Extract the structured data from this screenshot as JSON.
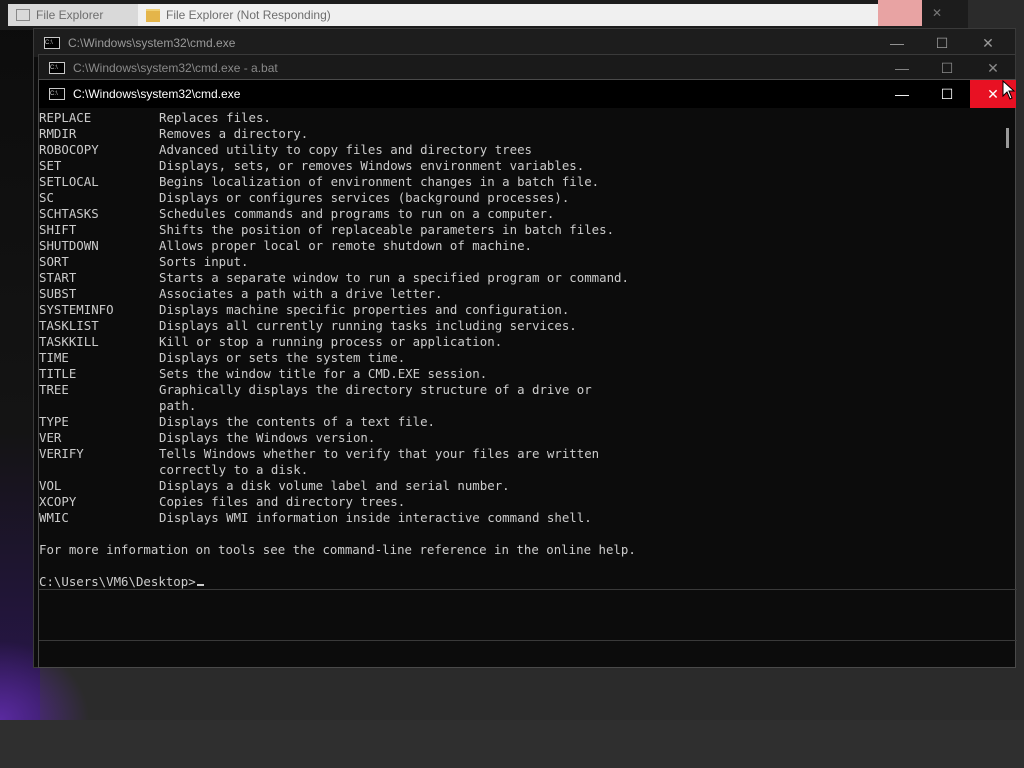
{
  "background_windows": {
    "tab1_title": "File Explorer",
    "tab2_title": "File Explorer (Not Responding)"
  },
  "window_back": {
    "title": "C:\\Windows\\system32\\cmd.exe"
  },
  "window_mid": {
    "title": "C:\\Windows\\system32\\cmd.exe - a.bat"
  },
  "window_front": {
    "title": "C:\\Windows\\system32\\cmd.exe"
  },
  "controls": {
    "minimize": "—",
    "maximize": "☐",
    "close": "✕"
  },
  "console": {
    "rows": [
      {
        "cmd": "REPLACE",
        "desc": "Replaces files."
      },
      {
        "cmd": "RMDIR",
        "desc": "Removes a directory."
      },
      {
        "cmd": "ROBOCOPY",
        "desc": "Advanced utility to copy files and directory trees"
      },
      {
        "cmd": "SET",
        "desc": "Displays, sets, or removes Windows environment variables."
      },
      {
        "cmd": "SETLOCAL",
        "desc": "Begins localization of environment changes in a batch file."
      },
      {
        "cmd": "SC",
        "desc": "Displays or configures services (background processes)."
      },
      {
        "cmd": "SCHTASKS",
        "desc": "Schedules commands and programs to run on a computer."
      },
      {
        "cmd": "SHIFT",
        "desc": "Shifts the position of replaceable parameters in batch files."
      },
      {
        "cmd": "SHUTDOWN",
        "desc": "Allows proper local or remote shutdown of machine."
      },
      {
        "cmd": "SORT",
        "desc": "Sorts input."
      },
      {
        "cmd": "START",
        "desc": "Starts a separate window to run a specified program or command."
      },
      {
        "cmd": "SUBST",
        "desc": "Associates a path with a drive letter."
      },
      {
        "cmd": "SYSTEMINFO",
        "desc": "Displays machine specific properties and configuration."
      },
      {
        "cmd": "TASKLIST",
        "desc": "Displays all currently running tasks including services."
      },
      {
        "cmd": "TASKKILL",
        "desc": "Kill or stop a running process or application."
      },
      {
        "cmd": "TIME",
        "desc": "Displays or sets the system time."
      },
      {
        "cmd": "TITLE",
        "desc": "Sets the window title for a CMD.EXE session."
      },
      {
        "cmd": "TREE",
        "desc": "Graphically displays the directory structure of a drive or"
      },
      {
        "cmd": "",
        "desc": "path."
      },
      {
        "cmd": "TYPE",
        "desc": "Displays the contents of a text file."
      },
      {
        "cmd": "VER",
        "desc": "Displays the Windows version."
      },
      {
        "cmd": "VERIFY",
        "desc": "Tells Windows whether to verify that your files are written"
      },
      {
        "cmd": "",
        "desc": "correctly to a disk."
      },
      {
        "cmd": "VOL",
        "desc": "Displays a disk volume label and serial number."
      },
      {
        "cmd": "XCOPY",
        "desc": "Copies files and directory trees."
      },
      {
        "cmd": "WMIC",
        "desc": "Displays WMI information inside interactive command shell."
      }
    ],
    "footer": "For more information on tools see the command-line reference in the online help.",
    "prompt": "C:\\Users\\VM6\\Desktop>"
  },
  "colors": {
    "console_bg": "#0c0c0c",
    "console_text": "#cccccc",
    "close_hover": "#e81123"
  }
}
